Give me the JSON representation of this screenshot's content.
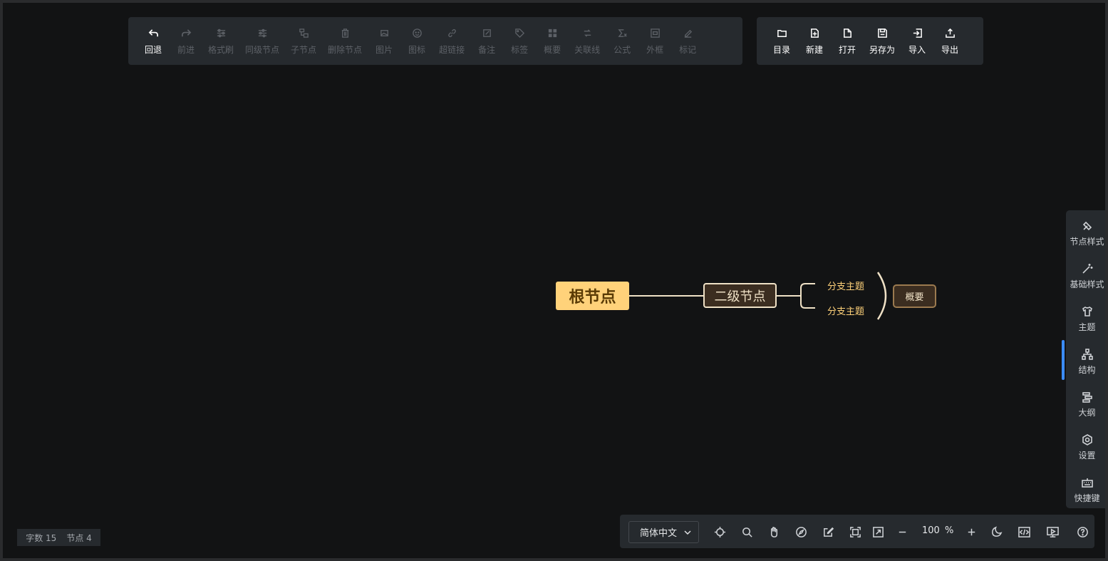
{
  "toolbar_left": [
    {
      "label": "回退",
      "icon": "undo-icon",
      "state": "active"
    },
    {
      "label": "前进",
      "icon": "redo-icon",
      "state": "disabled"
    },
    {
      "label": "格式刷",
      "icon": "format-brush-icon",
      "state": "disabled"
    },
    {
      "label": "同级节点",
      "icon": "sibling-node-icon",
      "state": "disabled"
    },
    {
      "label": "子节点",
      "icon": "child-node-icon",
      "state": "disabled"
    },
    {
      "label": "删除节点",
      "icon": "trash-icon",
      "state": "disabled"
    },
    {
      "label": "图片",
      "icon": "image-icon",
      "state": "disabled"
    },
    {
      "label": "图标",
      "icon": "smiley-icon",
      "state": "disabled"
    },
    {
      "label": "超链接",
      "icon": "link-icon",
      "state": "disabled"
    },
    {
      "label": "备注",
      "icon": "note-icon",
      "state": "disabled"
    },
    {
      "label": "标签",
      "icon": "tag-icon",
      "state": "disabled"
    },
    {
      "label": "概要",
      "icon": "summary-icon",
      "state": "disabled"
    },
    {
      "label": "关联线",
      "icon": "association-line-icon",
      "state": "disabled"
    },
    {
      "label": "公式",
      "icon": "formula-icon",
      "state": "disabled"
    },
    {
      "label": "外框",
      "icon": "outer-frame-icon",
      "state": "disabled"
    },
    {
      "label": "标记",
      "icon": "mark-icon",
      "state": "disabled"
    }
  ],
  "toolbar_right": [
    {
      "label": "目录",
      "icon": "folder-icon"
    },
    {
      "label": "新建",
      "icon": "new-file-icon"
    },
    {
      "label": "打开",
      "icon": "open-file-icon"
    },
    {
      "label": "另存为",
      "icon": "save-as-icon"
    },
    {
      "label": "导入",
      "icon": "import-icon"
    },
    {
      "label": "导出",
      "icon": "export-icon"
    }
  ],
  "mindmap": {
    "root": "根节点",
    "second": "二级节点",
    "branches": [
      "分支主题",
      "分支主题"
    ],
    "summary": "概要",
    "colors": {
      "root_bg": "#ffd27a",
      "root_text": "#5a3b05",
      "line": "#efe1c6",
      "branch_text": "#ffd27a",
      "node_bg": "#3b2d20"
    }
  },
  "sidebar": [
    {
      "label": "节点样式",
      "icon": "node-style-icon"
    },
    {
      "label": "基础样式",
      "icon": "magic-wand-icon"
    },
    {
      "label": "主题",
      "icon": "shirt-icon"
    },
    {
      "label": "结构",
      "icon": "structure-icon",
      "active": true
    },
    {
      "label": "大纲",
      "icon": "outline-icon"
    },
    {
      "label": "设置",
      "icon": "settings-icon"
    },
    {
      "label": "快捷键",
      "icon": "keyboard-icon"
    }
  ],
  "status": {
    "word_count_label": "字数 15",
    "node_count_label": "节点 4"
  },
  "bottombar": {
    "language": "简体中文",
    "zoom": "100",
    "zoom_unit": "%",
    "icons": [
      "locate-icon",
      "search-icon",
      "hand-icon",
      "compass-icon",
      "edit-icon",
      "fit-screen-icon",
      "fullscreen-icon",
      "zoom-out-icon",
      "zoom-in-icon",
      "dark-mode-icon",
      "code-icon",
      "presentation-icon",
      "help-icon"
    ]
  },
  "accent_color": "#3b8cff"
}
